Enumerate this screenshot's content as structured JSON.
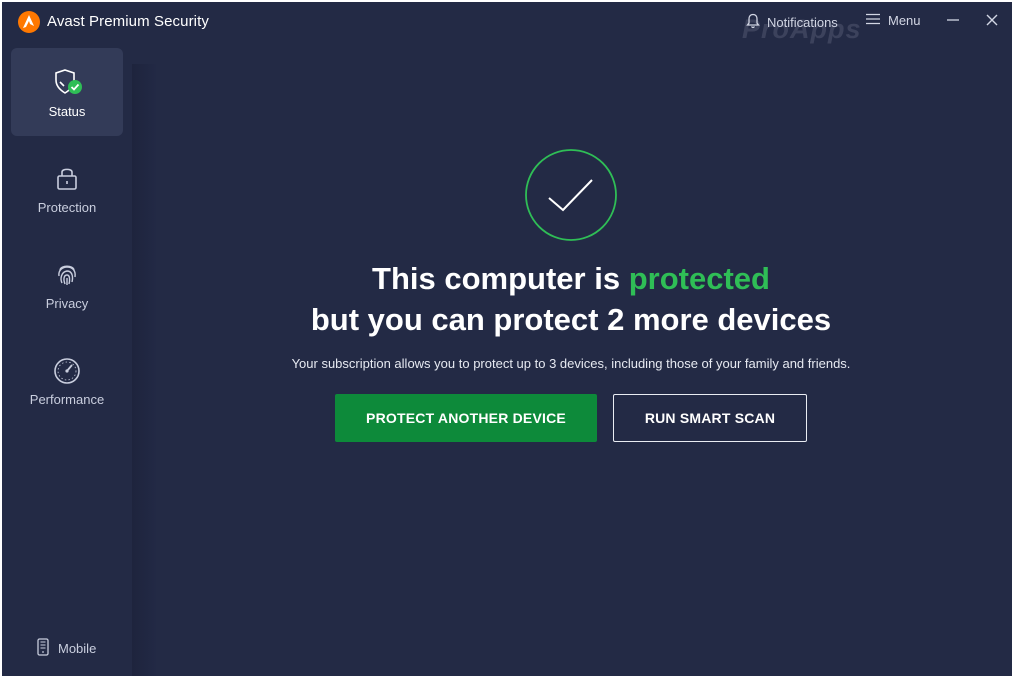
{
  "app": {
    "title": "Avast Premium Security",
    "brand_color": "#ff7800",
    "watermark": "ProApps"
  },
  "titlebar": {
    "notifications_label": "Notifications",
    "menu_label": "Menu"
  },
  "sidebar": {
    "items": [
      {
        "label": "Status",
        "icon": "shield-check-icon",
        "active": true
      },
      {
        "label": "Protection",
        "icon": "lock-icon",
        "active": false
      },
      {
        "label": "Privacy",
        "icon": "fingerprint-icon",
        "active": false
      },
      {
        "label": "Performance",
        "icon": "gauge-icon",
        "active": false
      }
    ],
    "mobile_label": "Mobile"
  },
  "main": {
    "status_icon": "checkmark-icon",
    "headline_prefix": "This computer is ",
    "headline_highlight": "protected",
    "headline_line2": "but you can protect 2 more devices",
    "subtext": "Your subscription allows you to protect up to 3 devices, including those of your family and friends.",
    "primary_button": "PROTECT ANOTHER DEVICE",
    "secondary_button": "RUN SMART SCAN"
  },
  "colors": {
    "background": "#232a45",
    "accent_green": "#2fbe56",
    "button_green": "#0d8a3a"
  }
}
